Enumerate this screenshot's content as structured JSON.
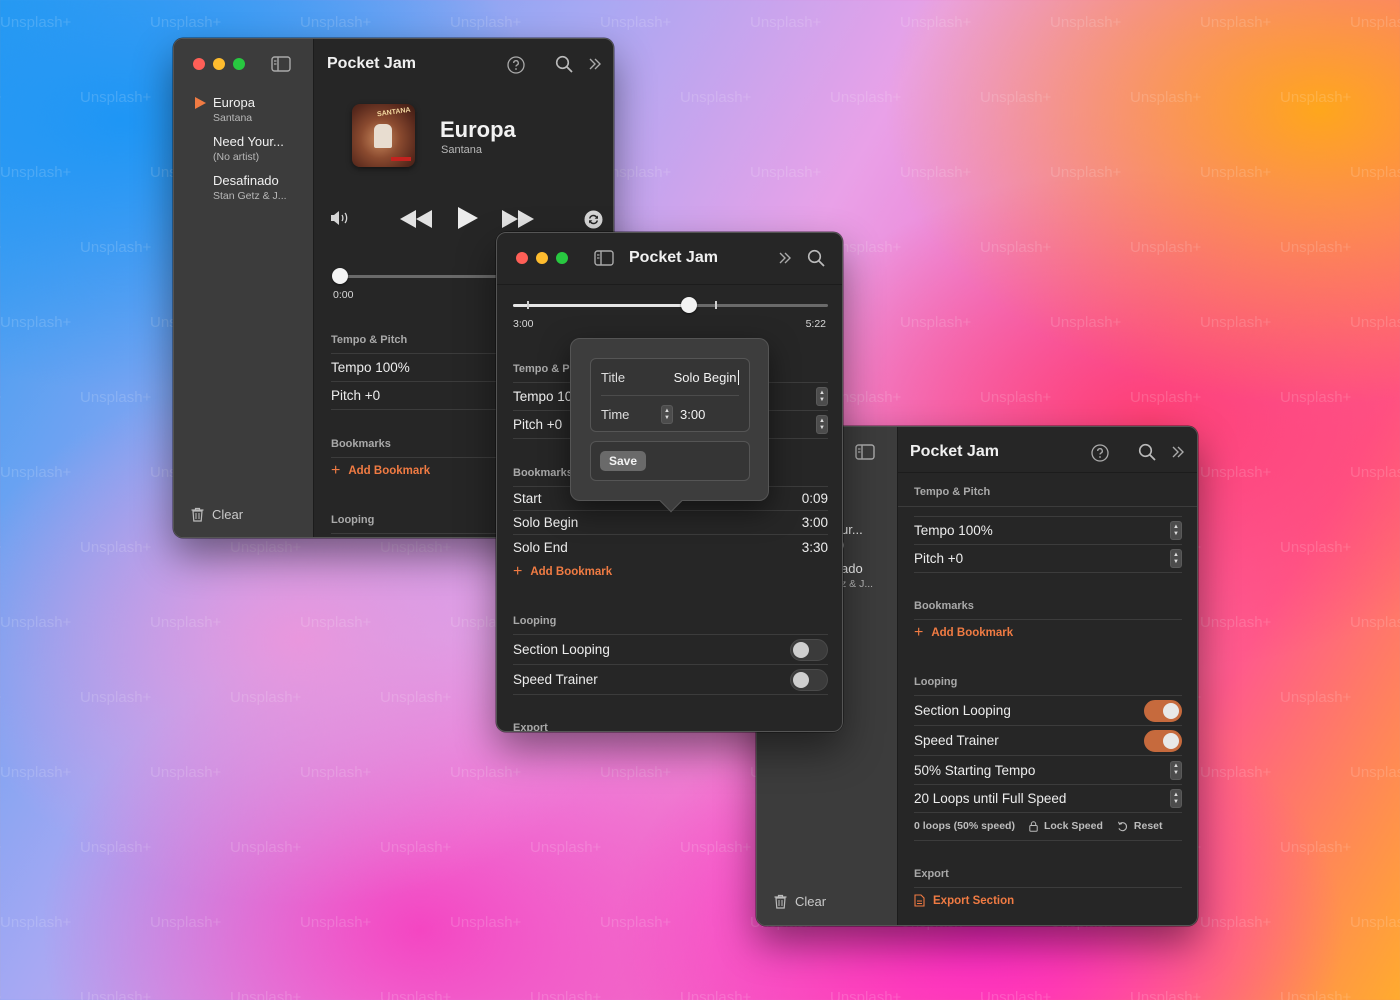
{
  "watermark": "Unsplash+",
  "app_title": "Pocket Jam",
  "songs": [
    {
      "title": "Europa",
      "artist": "Santana"
    },
    {
      "title": "Need Your...",
      "artist": "(No artist)"
    },
    {
      "title": "Desafinado",
      "artist": "Stan Getz & J..."
    }
  ],
  "now_playing": {
    "title": "Europa",
    "artist": "Santana",
    "album_text": "SANTANA"
  },
  "sidebar": {
    "clear_label": "Clear"
  },
  "window1": {
    "position_label": "0:00",
    "progress": 0.0,
    "sections": {
      "tempo_pitch": "Tempo & Pitch",
      "bookmarks": "Bookmarks",
      "looping": "Looping"
    },
    "tempo": "Tempo 100%",
    "pitch": "Pitch +0",
    "add_bookmark": "Add Bookmark"
  },
  "window2": {
    "position_label": "3:00",
    "duration_label": "5:22",
    "progress": 0.559,
    "sections": {
      "tempo_pitch": "Tempo & P",
      "bookmarks": "Bookmarks",
      "looping": "Looping",
      "export": "Export"
    },
    "tempo": "Tempo 10",
    "pitch": "Pitch +0",
    "bookmarks": [
      {
        "name": "Start",
        "time": "0:09"
      },
      {
        "name": "Solo Begin",
        "time": "3:00"
      },
      {
        "name": "Solo End",
        "time": "3:30"
      }
    ],
    "add_bookmark": "Add Bookmark",
    "section_looping": "Section Looping",
    "section_looping_on": false,
    "speed_trainer": "Speed Trainer",
    "speed_trainer_on": false
  },
  "popover": {
    "title_label": "Title",
    "title_value": "Solo Begin",
    "time_label": "Time",
    "time_value": "3:00",
    "save_label": "Save"
  },
  "window3": {
    "sidebar_songs_partial": [
      {
        "title": "ur...",
        "artist": ")"
      },
      {
        "title": "ado",
        "artist": "z & J..."
      }
    ],
    "sections": {
      "tempo_pitch": "Tempo & Pitch",
      "bookmarks": "Bookmarks",
      "looping": "Looping",
      "export": "Export"
    },
    "tempo": "Tempo 100%",
    "pitch": "Pitch +0",
    "add_bookmark": "Add Bookmark",
    "section_looping": "Section Looping",
    "section_looping_on": true,
    "speed_trainer": "Speed Trainer",
    "speed_trainer_on": true,
    "starting_tempo": "50% Starting Tempo",
    "loops_until_full": "20 Loops until Full Speed",
    "loops_status": "0 loops (50% speed)",
    "lock_speed": "Lock Speed",
    "reset": "Reset",
    "export_section": "Export Section"
  },
  "colors": {
    "accent": "#f07b43",
    "toggle_on": "#c66a3d"
  }
}
